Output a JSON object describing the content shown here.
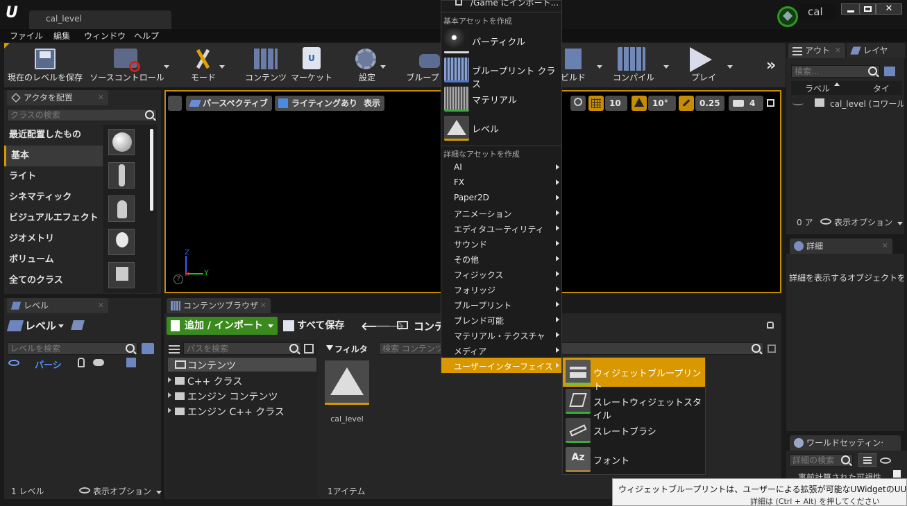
{
  "window": {
    "tab_title": "cal_level",
    "project_name": "cal"
  },
  "menubar": [
    "ファイル",
    "編集",
    "ウィンドウ",
    "ヘルプ"
  ],
  "toolbar": {
    "save_label": "現在のレベルを保存",
    "source_control_label": "ソースコントロール",
    "mode_label": "モード",
    "content_label": "コンテンツ",
    "market_label": "マーケット",
    "settings_label": "設定",
    "blueprint_label": "ブループ",
    "build_label": "ビルド",
    "compile_label": "コンパイル",
    "play_label": "プレイ"
  },
  "place_actors": {
    "tab_label": "アクタを配置",
    "search_placeholder": "クラスの検索",
    "categories": [
      "最近配置したもの",
      "基本",
      "ライト",
      "シネマティック",
      "ビジュアルエフェクト",
      "ジオメトリ",
      "ボリューム",
      "全てのクラス"
    ],
    "selected_category": "基本"
  },
  "viewport": {
    "perspective_label": "パースペクティブ",
    "lighting_label": "ライティングあり",
    "show_label": "表示",
    "grid_snap": "10",
    "rot_snap": "10°",
    "scale_snap": "0.25",
    "camera_speed": "4",
    "axis_z": "Z",
    "axis_y": "Y"
  },
  "levels_panel": {
    "tab_label": "レベル",
    "dropdown_label": "レベル",
    "search_placeholder": "レベルを検索",
    "level_row": "パーシ",
    "footer_count": "1 レベル",
    "view_options": "表示オプション"
  },
  "content_browser": {
    "tab_label": "コンテンツブラウザ",
    "add_import_label": "追加 / インポート",
    "save_all_label": "すべて保存",
    "path_label": "コンテ",
    "path_search_placeholder": "パスを検索",
    "filter_label": "フィルタ",
    "content_search_placeholder": "検索 コンテンツ",
    "folders": [
      "コンテンツ",
      "C++ クラス",
      "エンジン コンテンツ",
      "エンジン C++ クラス"
    ],
    "asset_name": "cal_level",
    "item_count": "1アイテム"
  },
  "outliner": {
    "tab1": "アウト",
    "tab2": "レイヤ",
    "search_placeholder": "検索...",
    "col_label": "ラベル",
    "col_type": "タイ",
    "row_label": "cal_level (コワールト",
    "count": "0 ア",
    "view_options": "表示オプション"
  },
  "details": {
    "tab_label": "詳細",
    "empty_message": "詳細を表示するオブジェクトを選"
  },
  "world_settings": {
    "tab_label": "ワールドセッティング",
    "search_placeholder": "詳細の検索",
    "partial_text": "事前計算された可視性"
  },
  "context_menu": {
    "top_item": "/Game にインポート...",
    "section_basic": "基本アセットを作成",
    "basic_items": [
      "パーティクル",
      "ブループリント クラス",
      "マテリアル",
      "レベル"
    ],
    "section_advanced": "詳細なアセットを作成",
    "advanced_items": [
      "AI",
      "FX",
      "Paper2D",
      "アニメーション",
      "エディタユーティリティ",
      "サウンド",
      "その他",
      "フィジックス",
      "フォリッジ",
      "ブループリント",
      "ブレンド可能",
      "マテリアル・テクスチャ",
      "メディア",
      "ユーザーインターフェイス"
    ],
    "highlighted_item": "ユーザーインターフェイス"
  },
  "submenu": {
    "items": [
      "ウィジェットブループリント",
      "スレートウィジェットスタイル",
      "スレートブラシ",
      "フォント"
    ],
    "highlighted_item": "ウィジェットブループリント"
  },
  "tooltip": {
    "line1": "ウィジェットブループリントは、ユーザーによる拡張が可能なUWidgetのUUserWidge",
    "line2": "詳細は (Ctrl + Alt) を押してください"
  },
  "colors": {
    "accent_orange": "#d99800",
    "menu_bg": "#1c1c1c",
    "panel_bg": "#262626",
    "add_button_green": "#3a8a1e"
  }
}
